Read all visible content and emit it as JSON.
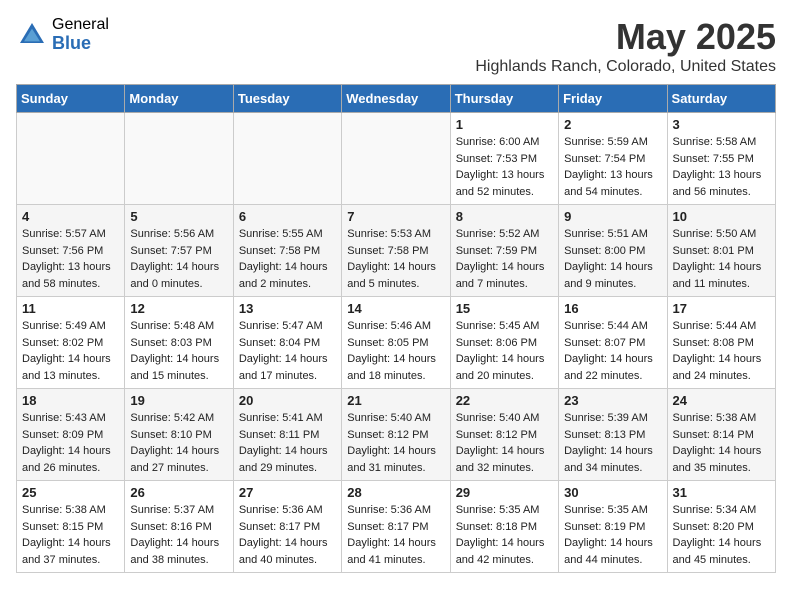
{
  "header": {
    "logo_general": "General",
    "logo_blue": "Blue",
    "month_title": "May 2025",
    "location": "Highlands Ranch, Colorado, United States"
  },
  "days_of_week": [
    "Sunday",
    "Monday",
    "Tuesday",
    "Wednesday",
    "Thursday",
    "Friday",
    "Saturday"
  ],
  "weeks": [
    [
      {
        "day": "",
        "info": ""
      },
      {
        "day": "",
        "info": ""
      },
      {
        "day": "",
        "info": ""
      },
      {
        "day": "",
        "info": ""
      },
      {
        "day": "1",
        "info": "Sunrise: 6:00 AM\nSunset: 7:53 PM\nDaylight: 13 hours\nand 52 minutes."
      },
      {
        "day": "2",
        "info": "Sunrise: 5:59 AM\nSunset: 7:54 PM\nDaylight: 13 hours\nand 54 minutes."
      },
      {
        "day": "3",
        "info": "Sunrise: 5:58 AM\nSunset: 7:55 PM\nDaylight: 13 hours\nand 56 minutes."
      }
    ],
    [
      {
        "day": "4",
        "info": "Sunrise: 5:57 AM\nSunset: 7:56 PM\nDaylight: 13 hours\nand 58 minutes."
      },
      {
        "day": "5",
        "info": "Sunrise: 5:56 AM\nSunset: 7:57 PM\nDaylight: 14 hours\nand 0 minutes."
      },
      {
        "day": "6",
        "info": "Sunrise: 5:55 AM\nSunset: 7:58 PM\nDaylight: 14 hours\nand 2 minutes."
      },
      {
        "day": "7",
        "info": "Sunrise: 5:53 AM\nSunset: 7:58 PM\nDaylight: 14 hours\nand 5 minutes."
      },
      {
        "day": "8",
        "info": "Sunrise: 5:52 AM\nSunset: 7:59 PM\nDaylight: 14 hours\nand 7 minutes."
      },
      {
        "day": "9",
        "info": "Sunrise: 5:51 AM\nSunset: 8:00 PM\nDaylight: 14 hours\nand 9 minutes."
      },
      {
        "day": "10",
        "info": "Sunrise: 5:50 AM\nSunset: 8:01 PM\nDaylight: 14 hours\nand 11 minutes."
      }
    ],
    [
      {
        "day": "11",
        "info": "Sunrise: 5:49 AM\nSunset: 8:02 PM\nDaylight: 14 hours\nand 13 minutes."
      },
      {
        "day": "12",
        "info": "Sunrise: 5:48 AM\nSunset: 8:03 PM\nDaylight: 14 hours\nand 15 minutes."
      },
      {
        "day": "13",
        "info": "Sunrise: 5:47 AM\nSunset: 8:04 PM\nDaylight: 14 hours\nand 17 minutes."
      },
      {
        "day": "14",
        "info": "Sunrise: 5:46 AM\nSunset: 8:05 PM\nDaylight: 14 hours\nand 18 minutes."
      },
      {
        "day": "15",
        "info": "Sunrise: 5:45 AM\nSunset: 8:06 PM\nDaylight: 14 hours\nand 20 minutes."
      },
      {
        "day": "16",
        "info": "Sunrise: 5:44 AM\nSunset: 8:07 PM\nDaylight: 14 hours\nand 22 minutes."
      },
      {
        "day": "17",
        "info": "Sunrise: 5:44 AM\nSunset: 8:08 PM\nDaylight: 14 hours\nand 24 minutes."
      }
    ],
    [
      {
        "day": "18",
        "info": "Sunrise: 5:43 AM\nSunset: 8:09 PM\nDaylight: 14 hours\nand 26 minutes."
      },
      {
        "day": "19",
        "info": "Sunrise: 5:42 AM\nSunset: 8:10 PM\nDaylight: 14 hours\nand 27 minutes."
      },
      {
        "day": "20",
        "info": "Sunrise: 5:41 AM\nSunset: 8:11 PM\nDaylight: 14 hours\nand 29 minutes."
      },
      {
        "day": "21",
        "info": "Sunrise: 5:40 AM\nSunset: 8:12 PM\nDaylight: 14 hours\nand 31 minutes."
      },
      {
        "day": "22",
        "info": "Sunrise: 5:40 AM\nSunset: 8:12 PM\nDaylight: 14 hours\nand 32 minutes."
      },
      {
        "day": "23",
        "info": "Sunrise: 5:39 AM\nSunset: 8:13 PM\nDaylight: 14 hours\nand 34 minutes."
      },
      {
        "day": "24",
        "info": "Sunrise: 5:38 AM\nSunset: 8:14 PM\nDaylight: 14 hours\nand 35 minutes."
      }
    ],
    [
      {
        "day": "25",
        "info": "Sunrise: 5:38 AM\nSunset: 8:15 PM\nDaylight: 14 hours\nand 37 minutes."
      },
      {
        "day": "26",
        "info": "Sunrise: 5:37 AM\nSunset: 8:16 PM\nDaylight: 14 hours\nand 38 minutes."
      },
      {
        "day": "27",
        "info": "Sunrise: 5:36 AM\nSunset: 8:17 PM\nDaylight: 14 hours\nand 40 minutes."
      },
      {
        "day": "28",
        "info": "Sunrise: 5:36 AM\nSunset: 8:17 PM\nDaylight: 14 hours\nand 41 minutes."
      },
      {
        "day": "29",
        "info": "Sunrise: 5:35 AM\nSunset: 8:18 PM\nDaylight: 14 hours\nand 42 minutes."
      },
      {
        "day": "30",
        "info": "Sunrise: 5:35 AM\nSunset: 8:19 PM\nDaylight: 14 hours\nand 44 minutes."
      },
      {
        "day": "31",
        "info": "Sunrise: 5:34 AM\nSunset: 8:20 PM\nDaylight: 14 hours\nand 45 minutes."
      }
    ]
  ]
}
